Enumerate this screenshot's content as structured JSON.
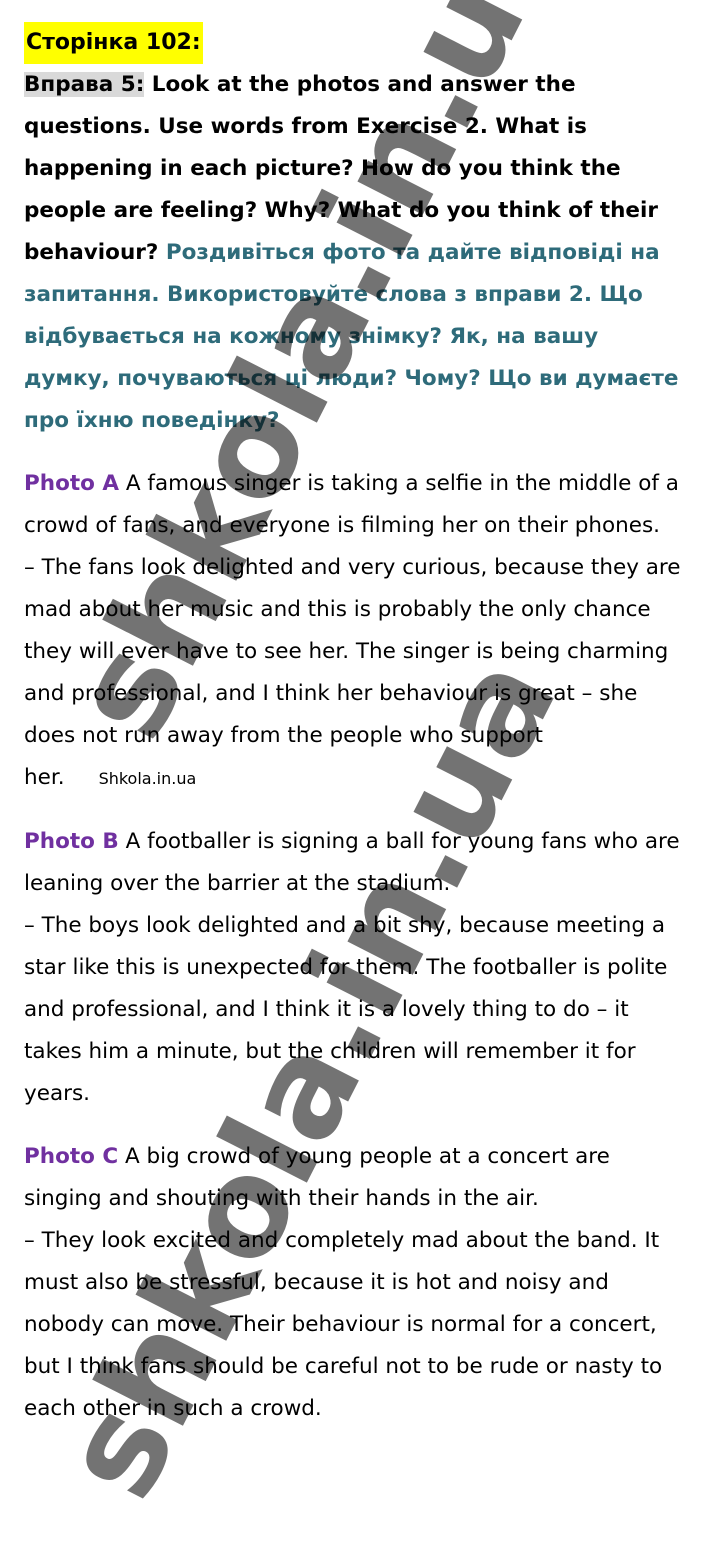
{
  "header": {
    "page_label": "Сторінка 102:"
  },
  "task": {
    "exercise_label": "Вправа 5:",
    "instruction_en": " Look at the photos and answer the questions. Use words from Exercise 2. What is happening in each picture? How do you think the people are feeling? Why? What do you think of their behaviour? ",
    "instruction_ua": "Роздивіться фото та дайте відповіді на запитання. Використовуйте слова з вправи 2. Що відбувається на кожному знімку? Як, на вашу думку, почуваються ці люди? Чому? Що ви думаєте про їхню поведінку?"
  },
  "photos": [
    {
      "label": "Photo A",
      "description": " A famous singer is taking a selfie in the middle of a crowd of fans, and everyone is filming her on their phones.",
      "answer": "– The fans look delighted and very curious, because they are mad about her music and this is probably the only chance they will ever have to see her. The singer is being charming and professional, and I think her behaviour is great – she does not run away from the people who support her.",
      "inline_mark": "Shkola.in.ua"
    },
    {
      "label": "Photo B",
      "description": " A footballer is signing a ball for young fans who are leaning over the barrier at the stadium.",
      "answer": "– The boys look delighted and a bit shy, because meeting a star like this is unexpected for them. The footballer is polite and professional, and I think it is a lovely thing to do – it takes him a minute, but the children will remember it for years."
    },
    {
      "label": "Photo C",
      "description": " A big crowd of young people at a concert are singing and shouting with their hands in the air.",
      "answer": "– They look excited and completely mad about the band. It must also be stressful, because it is hot and noisy and nobody can move. Their behaviour is normal for a concert, but I think fans should be careful not to be rude or nasty to each other in such a crowd."
    }
  ],
  "watermarks": [
    "shkola.in.ua",
    "shkola.in.ua"
  ],
  "colors": {
    "page_label_bg": "#ffff00",
    "exercise_label_bg": "#d9d9d9",
    "ukrainian_text": "#2e6b7a",
    "photo_label": "#7030a0"
  }
}
